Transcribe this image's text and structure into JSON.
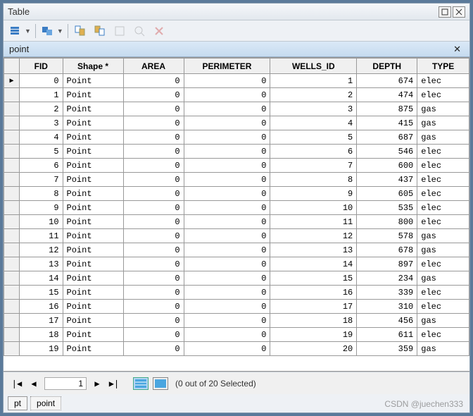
{
  "window": {
    "title": "Table"
  },
  "subheader": {
    "name": "point"
  },
  "columns": [
    "FID",
    "Shape *",
    "AREA",
    "PERIMETER",
    "WELLS_ID",
    "DEPTH",
    "TYPE"
  ],
  "col_align": [
    "num",
    "txt",
    "num",
    "num",
    "num",
    "num",
    "txt"
  ],
  "rows": [
    {
      "FID": 0,
      "Shape": "Point",
      "AREA": 0,
      "PERIMETER": 0,
      "WELLS_ID": 1,
      "DEPTH": 674,
      "TYPE": "elec"
    },
    {
      "FID": 1,
      "Shape": "Point",
      "AREA": 0,
      "PERIMETER": 0,
      "WELLS_ID": 2,
      "DEPTH": 474,
      "TYPE": "elec"
    },
    {
      "FID": 2,
      "Shape": "Point",
      "AREA": 0,
      "PERIMETER": 0,
      "WELLS_ID": 3,
      "DEPTH": 875,
      "TYPE": "gas"
    },
    {
      "FID": 3,
      "Shape": "Point",
      "AREA": 0,
      "PERIMETER": 0,
      "WELLS_ID": 4,
      "DEPTH": 415,
      "TYPE": "gas"
    },
    {
      "FID": 4,
      "Shape": "Point",
      "AREA": 0,
      "PERIMETER": 0,
      "WELLS_ID": 5,
      "DEPTH": 687,
      "TYPE": "gas"
    },
    {
      "FID": 5,
      "Shape": "Point",
      "AREA": 0,
      "PERIMETER": 0,
      "WELLS_ID": 6,
      "DEPTH": 546,
      "TYPE": "elec"
    },
    {
      "FID": 6,
      "Shape": "Point",
      "AREA": 0,
      "PERIMETER": 0,
      "WELLS_ID": 7,
      "DEPTH": 600,
      "TYPE": "elec"
    },
    {
      "FID": 7,
      "Shape": "Point",
      "AREA": 0,
      "PERIMETER": 0,
      "WELLS_ID": 8,
      "DEPTH": 437,
      "TYPE": "elec"
    },
    {
      "FID": 8,
      "Shape": "Point",
      "AREA": 0,
      "PERIMETER": 0,
      "WELLS_ID": 9,
      "DEPTH": 605,
      "TYPE": "elec"
    },
    {
      "FID": 9,
      "Shape": "Point",
      "AREA": 0,
      "PERIMETER": 0,
      "WELLS_ID": 10,
      "DEPTH": 535,
      "TYPE": "elec"
    },
    {
      "FID": 10,
      "Shape": "Point",
      "AREA": 0,
      "PERIMETER": 0,
      "WELLS_ID": 11,
      "DEPTH": 800,
      "TYPE": "elec"
    },
    {
      "FID": 11,
      "Shape": "Point",
      "AREA": 0,
      "PERIMETER": 0,
      "WELLS_ID": 12,
      "DEPTH": 578,
      "TYPE": "gas"
    },
    {
      "FID": 12,
      "Shape": "Point",
      "AREA": 0,
      "PERIMETER": 0,
      "WELLS_ID": 13,
      "DEPTH": 678,
      "TYPE": "gas"
    },
    {
      "FID": 13,
      "Shape": "Point",
      "AREA": 0,
      "PERIMETER": 0,
      "WELLS_ID": 14,
      "DEPTH": 897,
      "TYPE": "elec"
    },
    {
      "FID": 14,
      "Shape": "Point",
      "AREA": 0,
      "PERIMETER": 0,
      "WELLS_ID": 15,
      "DEPTH": 234,
      "TYPE": "gas"
    },
    {
      "FID": 15,
      "Shape": "Point",
      "AREA": 0,
      "PERIMETER": 0,
      "WELLS_ID": 16,
      "DEPTH": 339,
      "TYPE": "elec"
    },
    {
      "FID": 16,
      "Shape": "Point",
      "AREA": 0,
      "PERIMETER": 0,
      "WELLS_ID": 17,
      "DEPTH": 310,
      "TYPE": "elec"
    },
    {
      "FID": 17,
      "Shape": "Point",
      "AREA": 0,
      "PERIMETER": 0,
      "WELLS_ID": 18,
      "DEPTH": 456,
      "TYPE": "gas"
    },
    {
      "FID": 18,
      "Shape": "Point",
      "AREA": 0,
      "PERIMETER": 0,
      "WELLS_ID": 19,
      "DEPTH": 611,
      "TYPE": "elec"
    },
    {
      "FID": 19,
      "Shape": "Point",
      "AREA": 0,
      "PERIMETER": 0,
      "WELLS_ID": 20,
      "DEPTH": 359,
      "TYPE": "gas"
    }
  ],
  "nav": {
    "current_record": "1",
    "status": "(0 out of 20 Selected)"
  },
  "tabs": [
    "pt",
    "point"
  ],
  "watermark": "CSDN @juechen333"
}
